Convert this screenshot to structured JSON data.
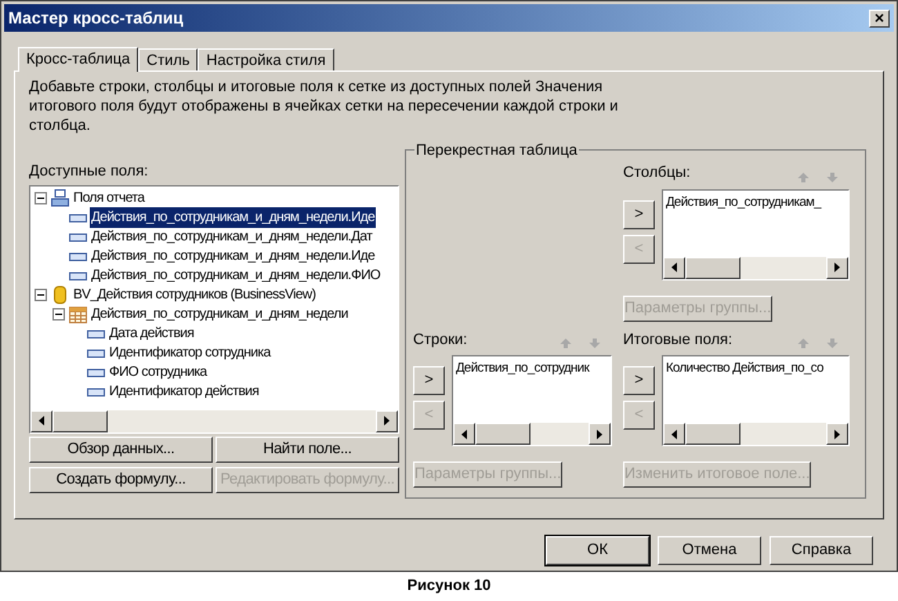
{
  "window": {
    "title": "Мастер кросс-таблиц",
    "close": "×"
  },
  "tabs": [
    {
      "label": "Кросс-таблица",
      "selected": true
    },
    {
      "label": "Стиль",
      "selected": false
    },
    {
      "label": "Настройка стиля",
      "selected": false
    }
  ],
  "instructions": "Добавьте строки, столбцы и итоговые поля к сетке из доступных полей Значения итогового поля будут отображены в ячейках сетки на пересечении каждой строки и столбца.",
  "available_fields": {
    "label": "Доступные поля:",
    "tree": [
      {
        "kind": "report",
        "label": "Поля отчета",
        "expanded": true,
        "selected": false,
        "children": [
          {
            "kind": "field",
            "label": "Действия_по_сотрудникам_и_дням_недели.Иде",
            "selected": true
          },
          {
            "kind": "field",
            "label": "Действия_по_сотрудникам_и_дням_недели.Дат",
            "selected": false
          },
          {
            "kind": "field",
            "label": "Действия_по_сотрудникам_и_дням_недели.Иде",
            "selected": false
          },
          {
            "kind": "field",
            "label": "Действия_по_сотрудникам_и_дням_недели.ФИО",
            "selected": false
          }
        ]
      },
      {
        "kind": "database",
        "label": "BV_Действия сотрудников (BusinessView)",
        "expanded": true,
        "selected": false,
        "children": [
          {
            "kind": "table",
            "label": "Действия_по_сотрудникам_и_дням_недели",
            "expanded": true,
            "selected": false,
            "children": [
              {
                "kind": "field",
                "label": "Дата действия",
                "selected": false
              },
              {
                "kind": "field",
                "label": "Идентификатор сотрудника",
                "selected": false
              },
              {
                "kind": "field",
                "label": "ФИО сотрудника",
                "selected": false
              },
              {
                "kind": "field",
                "label": "Идентификатор действия",
                "selected": false
              }
            ]
          }
        ]
      }
    ]
  },
  "field_buttons": [
    {
      "label": "Обзор данных...",
      "disabled": false
    },
    {
      "label": "Найти поле...",
      "disabled": false
    },
    {
      "label": "Создать формулу...",
      "disabled": false
    },
    {
      "label": "Редактировать формулу...",
      "disabled": true
    }
  ],
  "crosstab": {
    "title": "Перекрестная таблица",
    "columns": {
      "label": "Столбцы:",
      "items": [
        "Действия_по_сотрудникам_"
      ],
      "add": {
        "label": ">",
        "disabled": false
      },
      "remove": {
        "label": "<",
        "disabled": true
      },
      "button": {
        "label": "Параметры группы...",
        "disabled": true
      }
    },
    "rows": {
      "label": "Строки:",
      "items": [
        "Действия_по_сотрудник"
      ],
      "add": {
        "label": ">",
        "disabled": false
      },
      "remove": {
        "label": "<",
        "disabled": true
      },
      "button": {
        "label": "Параметры группы...",
        "disabled": true
      }
    },
    "summary": {
      "label": "Итоговые поля:",
      "items": [
        "Количество Действия_по_со"
      ],
      "add": {
        "label": ">",
        "disabled": false
      },
      "remove": {
        "label": "<",
        "disabled": true
      },
      "button": {
        "label": "Изменить итоговое поле...",
        "disabled": true
      }
    }
  },
  "footer_buttons": [
    {
      "label": "ОК",
      "default": true
    },
    {
      "label": "Отмена",
      "default": false
    },
    {
      "label": "Справка",
      "default": false
    }
  ],
  "caption": "Рисунок 10"
}
